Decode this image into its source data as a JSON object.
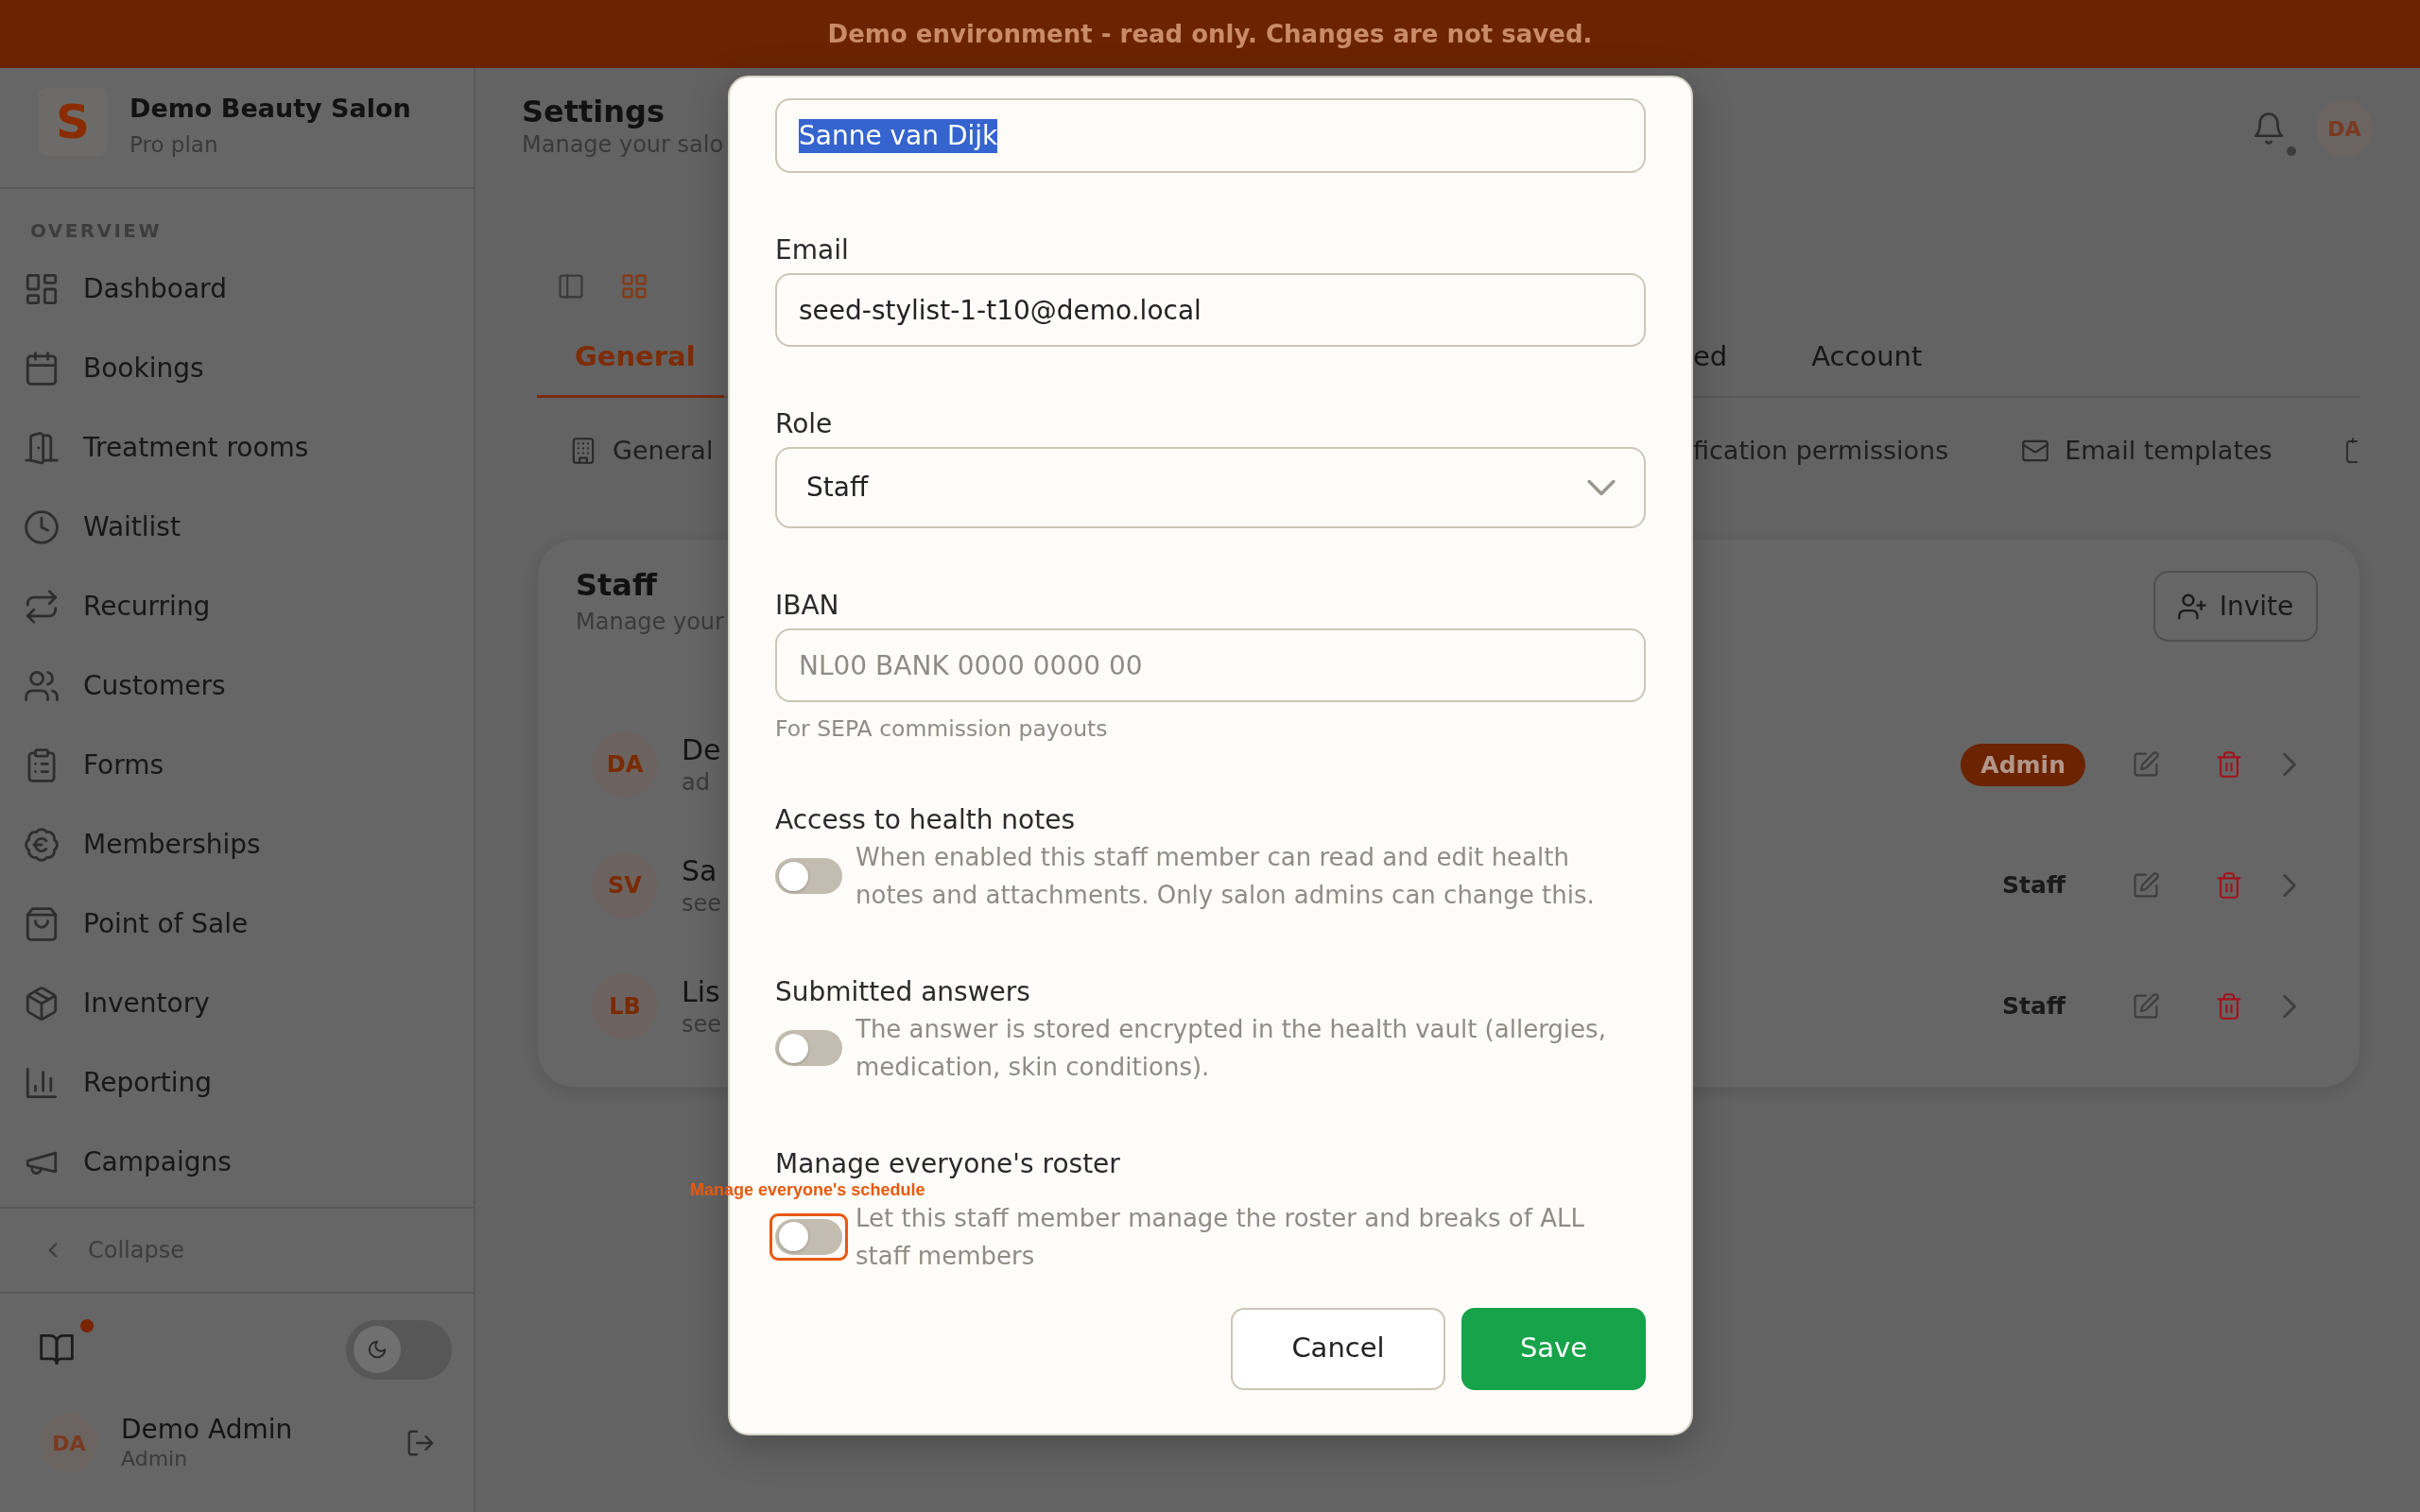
{
  "banner": {
    "text": "Demo environment - read only. Changes are not saved."
  },
  "sidebar": {
    "brand": {
      "logo": "S",
      "name": "Demo Beauty Salon",
      "plan": "Pro plan"
    },
    "section": "OVERVIEW",
    "items": [
      {
        "label": "Dashboard",
        "selected": false
      },
      {
        "label": "Bookings",
        "selected": false
      },
      {
        "label": "Treatment rooms",
        "selected": false
      },
      {
        "label": "Waitlist",
        "selected": false
      },
      {
        "label": "Recurring",
        "selected": false
      },
      {
        "label": "Customers",
        "selected": false
      },
      {
        "label": "Forms",
        "selected": false
      },
      {
        "label": "Memberships",
        "selected": false
      },
      {
        "label": "Point of Sale",
        "selected": false
      },
      {
        "label": "Inventory",
        "selected": false
      },
      {
        "label": "Reporting",
        "selected": false
      },
      {
        "label": "Campaigns",
        "selected": false
      }
    ],
    "collapse": "Collapse",
    "guide": {
      "unread": true
    },
    "dark_mode": false,
    "user": {
      "initials": "DA",
      "name": "Demo Admin",
      "role": "Admin"
    }
  },
  "header": {
    "title": "Settings",
    "subtitle": "Manage your salo",
    "notifications_unread": true,
    "avatar": "DA"
  },
  "view_modes": [
    {
      "selected": false
    },
    {
      "selected": true
    }
  ],
  "tabs": [
    {
      "label": "General",
      "selected": true
    },
    {
      "label": "ed",
      "selected": false
    },
    {
      "label": "Account",
      "selected": false
    }
  ],
  "subtabs": [
    {
      "label": "General",
      "selected": false
    },
    {
      "label": "fication permissions",
      "selected": false
    },
    {
      "label": "Email templates",
      "selected": false
    },
    {
      "selected": false
    }
  ],
  "staff_card": {
    "title": "Staff",
    "subtitle": "Manage your",
    "invite": "Invite",
    "rows": [
      {
        "initials": "DA",
        "name": "De",
        "subtitle": "ad",
        "kind": "admin",
        "role": "Admin"
      },
      {
        "initials": "SV",
        "name": "Sa",
        "subtitle": "see",
        "kind": "staff",
        "role": "Staff"
      },
      {
        "initials": "LB",
        "name": "Lis",
        "subtitle": "see",
        "kind": "staff",
        "role": "Staff"
      }
    ]
  },
  "modal": {
    "fields": [
      {
        "kind": "text",
        "value": "Sanne van Dijk",
        "text_selected": true
      },
      {
        "kind": "text",
        "label": "Email",
        "value": "seed-stylist-1-t10@demo.local"
      },
      {
        "kind": "select",
        "label": "Role",
        "value": "Staff"
      },
      {
        "kind": "text",
        "label": "IBAN",
        "placeholder": "NL00 BANK 0000 0000 00",
        "help": "For SEPA commission payouts"
      }
    ],
    "toggles": [
      {
        "label": "Access to health notes",
        "description": "When enabled this staff member can read and edit health notes and attachments. Only salon admins can change this.",
        "on": false
      },
      {
        "label": "Submitted answers",
        "description": "The answer is stored encrypted in the health vault (allergies, medication, skin conditions).",
        "on": false
      },
      {
        "label": "Manage everyone's roster",
        "description": "Let this staff member manage the roster and breaks of ALL staff members",
        "on": false,
        "highlighted": true,
        "annotation": "Manage everyone's schedule"
      }
    ],
    "buttons": [
      {
        "label": "Cancel",
        "kind": "secondary"
      },
      {
        "label": "Save",
        "kind": "primary"
      }
    ]
  }
}
